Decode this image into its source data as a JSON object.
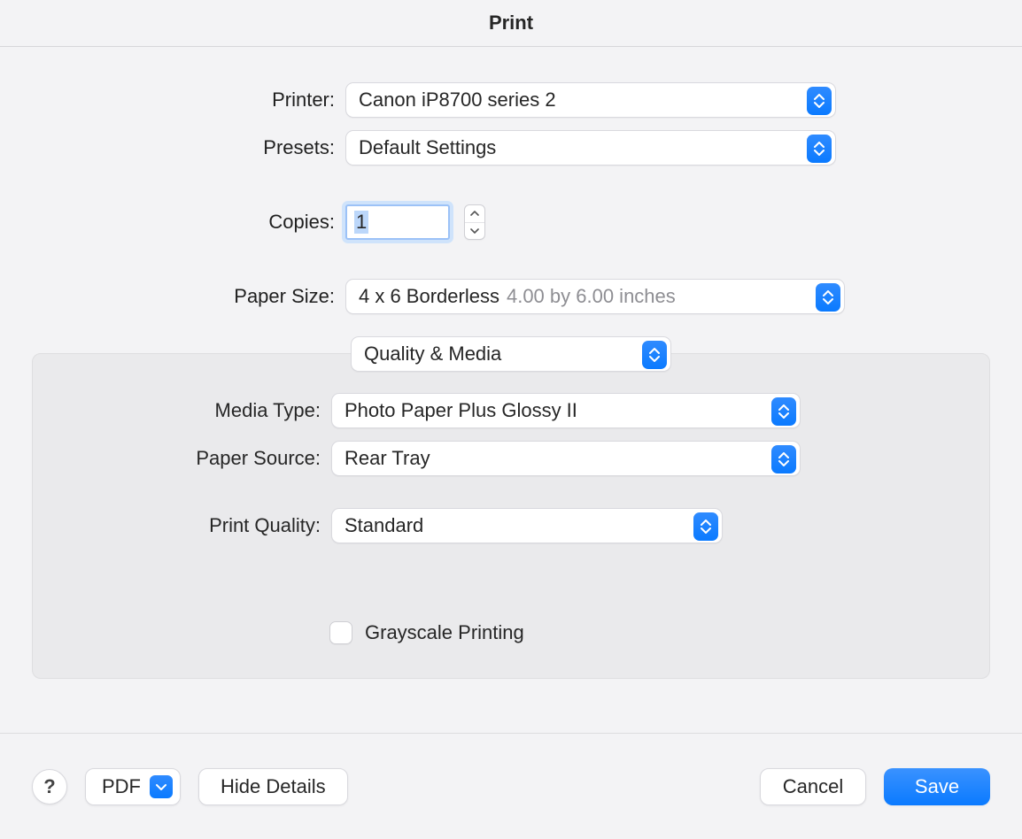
{
  "title": "Print",
  "labels": {
    "printer": "Printer:",
    "presets": "Presets:",
    "copies": "Copies:",
    "paperSize": "Paper Size:",
    "mediaType": "Media Type:",
    "paperSource": "Paper Source:",
    "printQuality": "Print Quality:"
  },
  "printer": {
    "value": "Canon iP8700 series 2"
  },
  "presets": {
    "value": "Default Settings"
  },
  "copies": {
    "value": "1"
  },
  "paperSize": {
    "value": "4 x 6 Borderless",
    "detail": "4.00 by 6.00 inches"
  },
  "section": {
    "value": "Quality & Media"
  },
  "mediaType": {
    "value": "Photo Paper Plus Glossy II"
  },
  "paperSource": {
    "value": "Rear Tray"
  },
  "printQuality": {
    "value": "Standard"
  },
  "grayscale": {
    "label": "Grayscale Printing",
    "checked": false
  },
  "footer": {
    "help": "?",
    "pdf": "PDF",
    "hideDetails": "Hide Details",
    "cancel": "Cancel",
    "save": "Save"
  }
}
